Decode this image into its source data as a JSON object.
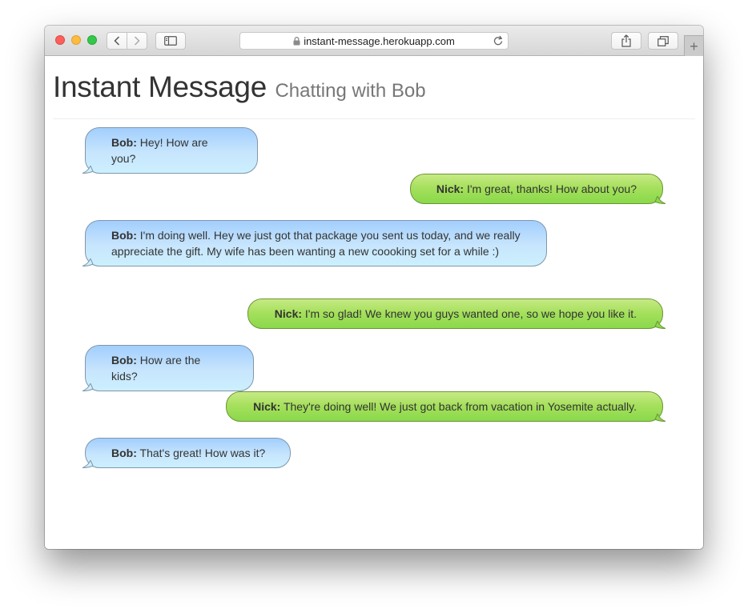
{
  "browser": {
    "url": "instant-message.herokuapp.com"
  },
  "page": {
    "title": "Instant Message",
    "subtitle": "Chatting with Bob"
  },
  "messages": [
    {
      "sender": "Bob:",
      "text": "Hey! How are you?"
    },
    {
      "sender": "Nick:",
      "text": "I'm great, thanks! How about you?"
    },
    {
      "sender": "Bob:",
      "text": "I'm doing well. Hey we just got that package you sent us today, and we really appreciate the gift. My wife has been wanting a new coooking set for a while :)"
    },
    {
      "sender": "Nick:",
      "text": "I'm so glad! We knew you guys wanted one, so we hope you like it."
    },
    {
      "sender": "Bob:",
      "text": "How are the kids?"
    },
    {
      "sender": "Nick:",
      "text": "They're doing well! We just got back from vacation in Yosemite actually."
    },
    {
      "sender": "Bob:",
      "text": "That's great! How was it?"
    }
  ],
  "colors": {
    "bob_bubble_top": "#a2cefd",
    "bob_bubble_bottom": "#ccf0fe",
    "nick_bubble_top": "#c7ea85",
    "nick_bubble_bottom": "#8ad94b"
  }
}
